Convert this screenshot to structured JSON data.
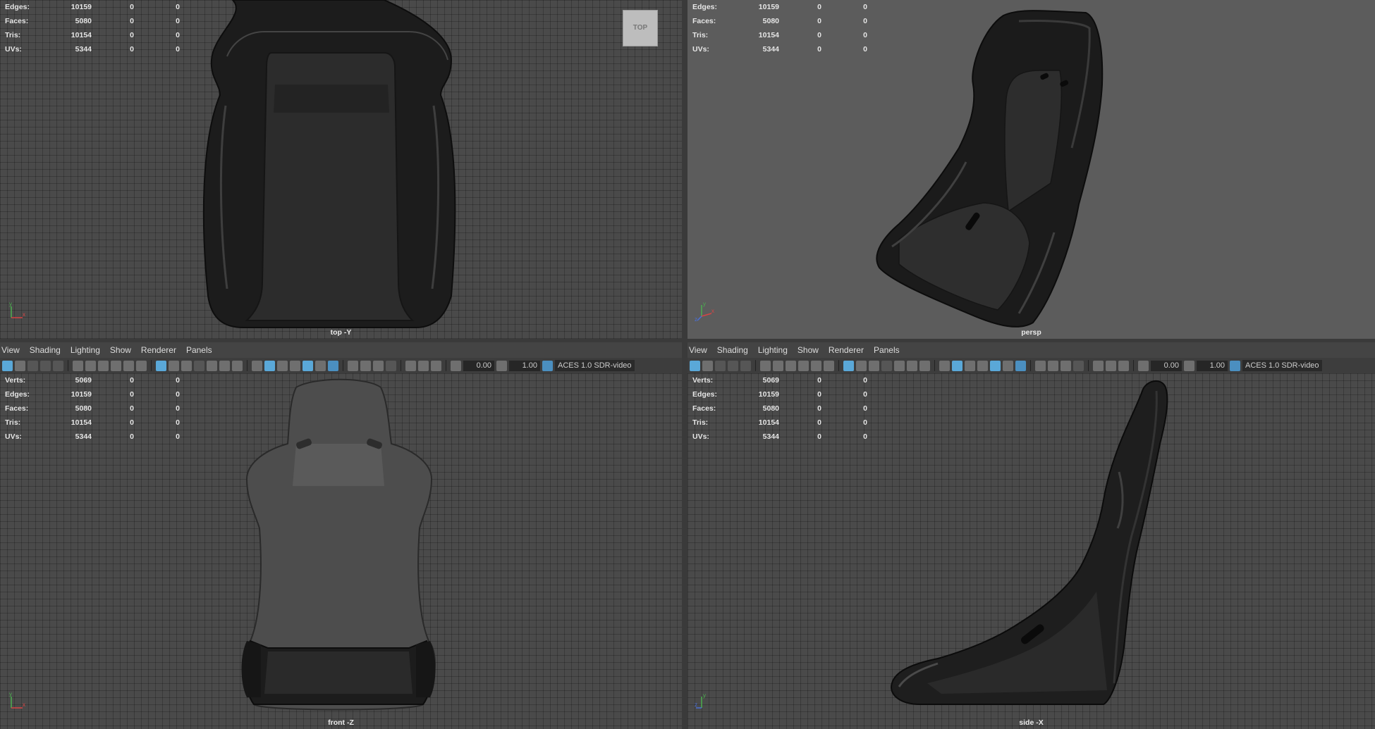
{
  "menus": [
    "View",
    "Shading",
    "Lighting",
    "Show",
    "Renderer",
    "Panels"
  ],
  "toolbar": {
    "exposure": "0.00",
    "gamma": "1.00",
    "color_space": "ACES 1.0 SDR-video"
  },
  "stat_labels": [
    "Verts:",
    "Edges:",
    "Faces:",
    "Tris:",
    "UVs:"
  ],
  "stats_partial": [
    [
      "Edges:",
      "10159",
      "0",
      "0"
    ],
    [
      "Faces:",
      "5080",
      "0",
      "0"
    ],
    [
      "Tris:",
      "10154",
      "0",
      "0"
    ],
    [
      "UVs:",
      "5344",
      "0",
      "0"
    ]
  ],
  "stats_full": [
    [
      "Verts:",
      "5069",
      "0",
      "0"
    ],
    [
      "Edges:",
      "10159",
      "0",
      "0"
    ],
    [
      "Faces:",
      "5080",
      "0",
      "0"
    ],
    [
      "Tris:",
      "10154",
      "0",
      "0"
    ],
    [
      "UVs:",
      "5344",
      "0",
      "0"
    ]
  ],
  "viewports": {
    "top": {
      "label": "top -Y",
      "view_cube": "TOP"
    },
    "persp": {
      "label": "persp"
    },
    "front": {
      "label": "front -Z"
    },
    "side": {
      "label": "side -X"
    }
  },
  "colors": {
    "grid_bg": "#4a4a4a",
    "persp_bg": "#5c5c5c",
    "panel_bar": "#444444",
    "highlight": "#5aa8d8"
  },
  "axis_letters": {
    "x": "x",
    "y": "y",
    "z": "z"
  }
}
